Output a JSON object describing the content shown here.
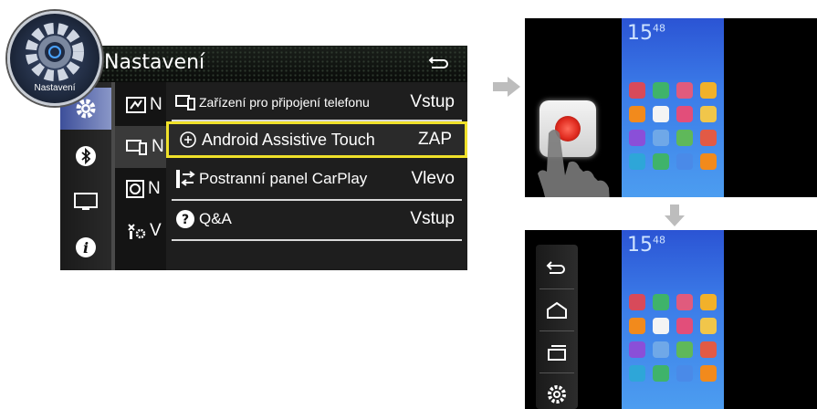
{
  "settings": {
    "title": "Nastavení",
    "badge_label": "Nastavení",
    "submenu_letters": [
      "N",
      "N",
      "N",
      "V"
    ],
    "popup_rows": [
      {
        "label": "Zařízení pro připojení telefonu",
        "value": "Vstup",
        "icon": "phone-connect-icon"
      },
      {
        "label": "Android Assistive Touch",
        "value": "ZAP",
        "icon": "assistive-touch-icon"
      },
      {
        "label": "Postranní panel CarPlay",
        "value": "Vlevo",
        "icon": "carplay-sidebar-icon"
      },
      {
        "label": "Q&A",
        "value": "Vstup",
        "icon": "question-icon"
      }
    ],
    "categories": [
      "gear-icon",
      "bluetooth-icon",
      "display-icon",
      "info-icon"
    ],
    "accent_color": "#f0e12a"
  },
  "phone": {
    "clock_hour": "15",
    "clock_min": "48"
  },
  "side_menu": {
    "items": [
      "back-icon",
      "home-icon",
      "recent-apps-icon",
      "settings-icon"
    ]
  }
}
